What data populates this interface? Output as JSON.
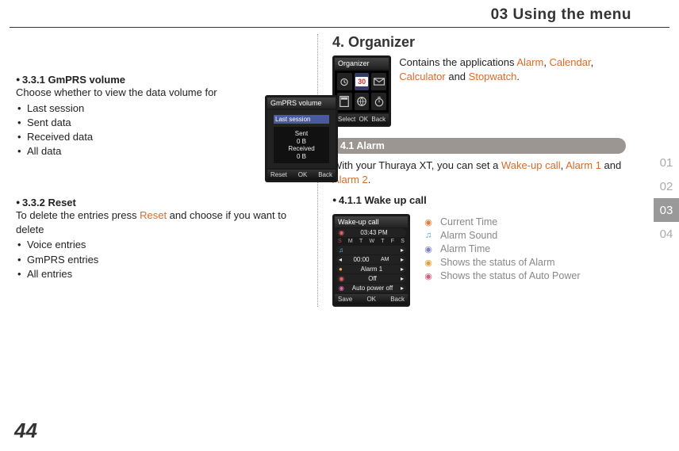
{
  "header": {
    "title": "03 Using the menu"
  },
  "tabs": [
    "01",
    "02",
    "03",
    "04"
  ],
  "tabs_active_index": 2,
  "page_number": "44",
  "left": {
    "s331_title": "3.3.1  GmPRS volume",
    "s331_intro": "Choose whether to view the data volume for",
    "s331_items": [
      "Last session",
      "Sent data",
      "Received data",
      "All data"
    ],
    "s332_title": "3.3.2  Reset",
    "s332_text_before": "To delete the entries press ",
    "s332_hl": "Reset",
    "s332_text_after": " and choose if you want to delete",
    "s332_items": [
      "Voice entries",
      "GmPRS entries",
      "All entries"
    ]
  },
  "gmprs_screen": {
    "title": "GmPRS volume",
    "row": "Last session",
    "box_lines": [
      "Sent",
      "0 B",
      "Received",
      "0 B"
    ],
    "soft_left": "Reset",
    "soft_mid": "OK",
    "soft_right": "Back"
  },
  "right": {
    "heading": "4. Organizer",
    "intro_before": "Contains the applications ",
    "intro_hl1": "Alarm",
    "intro_sep1": ", ",
    "intro_hl2": "Calendar",
    "intro_sep2": ", ",
    "intro_hl3": "Calculator",
    "intro_sep3": " and ",
    "intro_hl4": "Stopwatch",
    "intro_end": ".",
    "pill": "4.1  Alarm",
    "alarm_text_before": "With your Thuraya XT, you can set a ",
    "alarm_hl1": "Wake-up call",
    "alarm_sep1": ", ",
    "alarm_hl2": "Alarm 1",
    "alarm_sep2": " and ",
    "alarm_hl3": "Alarm 2",
    "alarm_end": ".",
    "s411_title": "4.1.1  Wake up call",
    "legend": [
      "Current Time",
      "Alarm Sound",
      "Alarm Time",
      "Shows the status of Alarm",
      "Shows the status of Auto Power"
    ]
  },
  "org_screen": {
    "title": "Organizer",
    "cal_text": "30",
    "soft_left": "Select",
    "soft_mid": "OK",
    "soft_right": "Back"
  },
  "wake_screen": {
    "title": "Wake-up call",
    "time": "03:43 PM",
    "days": [
      "S",
      "M",
      "T",
      "W",
      "T",
      "F",
      "S"
    ],
    "rows": [
      {
        "icon": "note",
        "val": "",
        "arrow": true
      },
      {
        "icon": "clock",
        "val": "00:00",
        "tag": "AM",
        "arrows": true
      },
      {
        "icon": "bell",
        "val": "Alarm 1",
        "arrow": true
      },
      {
        "icon": "dot",
        "val": "Off",
        "arrow": true
      },
      {
        "icon": "power",
        "val": "Auto power off",
        "arrow": true
      }
    ],
    "soft_left": "Save",
    "soft_mid": "OK",
    "soft_right": "Back"
  }
}
